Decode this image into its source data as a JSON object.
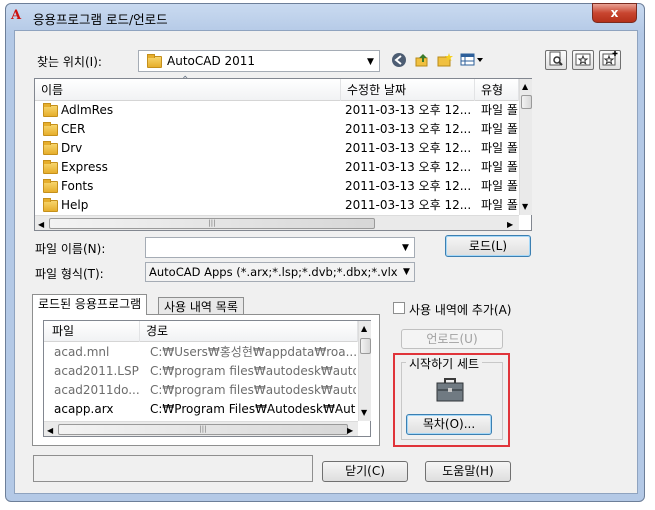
{
  "window": {
    "title": "응용프로그램 로드/언로드",
    "close_label": "x"
  },
  "lookin": {
    "label": "찾는 위치(I):",
    "value": "AutoCAD 2011",
    "toolbar": [
      "back-icon",
      "up-folder-icon",
      "new-folder-icon",
      "views-icon"
    ],
    "right_tools": [
      "find-icon",
      "favorites-icon",
      "add-favorite-icon"
    ]
  },
  "file_list": {
    "columns": [
      "이름",
      "수정한 날짜",
      "유형"
    ],
    "rows": [
      {
        "name": "AdlmRes",
        "date": "2011-03-13 오후 12...",
        "type": "파일 폴더"
      },
      {
        "name": "CER",
        "date": "2011-03-13 오후 12...",
        "type": "파일 폴더"
      },
      {
        "name": "Drv",
        "date": "2011-03-13 오후 12...",
        "type": "파일 폴더"
      },
      {
        "name": "Express",
        "date": "2011-03-13 오후 12...",
        "type": "파일 폴더"
      },
      {
        "name": "Fonts",
        "date": "2011-03-13 오후 12...",
        "type": "파일 폴더"
      },
      {
        "name": "Help",
        "date": "2011-03-13 오후 12...",
        "type": "파일 폴더"
      }
    ]
  },
  "filename": {
    "label": "파일 이름(N):",
    "value": "",
    "load_label": "로드(L)"
  },
  "filetype": {
    "label": "파일 형식(T):",
    "value": "AutoCAD Apps (*.arx;*.lsp;*.dvb;*.dbx;*.vlx"
  },
  "tabs": [
    "로드된 응용프로그램",
    "사용 내역 목록"
  ],
  "loaded": {
    "columns": [
      "파일",
      "경로"
    ],
    "rows": [
      {
        "file": "acad.mnl",
        "path": "C:₩Users₩홍성현₩appdata₩roa...",
        "active": false
      },
      {
        "file": "acad2011.LSP",
        "path": "C:₩program files₩autodesk₩auto...",
        "active": false
      },
      {
        "file": "acad2011do...",
        "path": "C:₩program files₩autodesk₩auto...",
        "active": false
      },
      {
        "file": "acapp.arx",
        "path": "C:₩Program Files₩Autodesk₩Aut...",
        "active": true
      }
    ]
  },
  "history_checkbox": {
    "label": "사용 내역에 추가(A)",
    "checked": false
  },
  "unload_label": "언로드(U)",
  "startup_suite": {
    "title": "시작하기 세트",
    "contents_label": "목차(O)...",
    "highlight_color": "#e0343a"
  },
  "status_text": "",
  "close_label": "닫기(C)",
  "help_label": "도움말(H)"
}
